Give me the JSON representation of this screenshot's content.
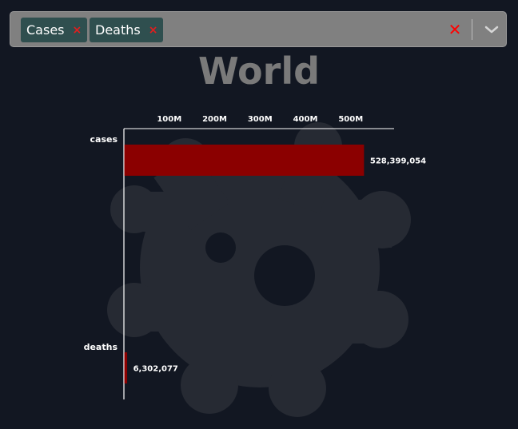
{
  "filter": {
    "chips": [
      {
        "label": "Cases",
        "remove_icon": "×"
      },
      {
        "label": "Deaths",
        "remove_icon": "×"
      }
    ],
    "clear_icon": "✕",
    "dropdown_icon": "chevron-down-icon"
  },
  "colors": {
    "background": "#121722",
    "bar": "#8b0000",
    "axis": "#ffffff",
    "text": "#ffffff",
    "title": "#7a7a7a",
    "watermark": "#262a33"
  },
  "chart_data": {
    "type": "bar",
    "orientation": "horizontal",
    "title": "World",
    "categories": [
      "cases",
      "deaths"
    ],
    "values": [
      528399054,
      6302077
    ],
    "value_labels": [
      "528,399,054",
      "6,302,077"
    ],
    "xticks": [
      100000000,
      200000000,
      300000000,
      400000000,
      500000000
    ],
    "xtick_labels": [
      "100M",
      "200M",
      "300M",
      "400M",
      "500M"
    ],
    "xlim": [
      0,
      600000000
    ],
    "x_axis_position": "top",
    "grid": false,
    "legend": "none",
    "watermark": "virus-icon"
  }
}
